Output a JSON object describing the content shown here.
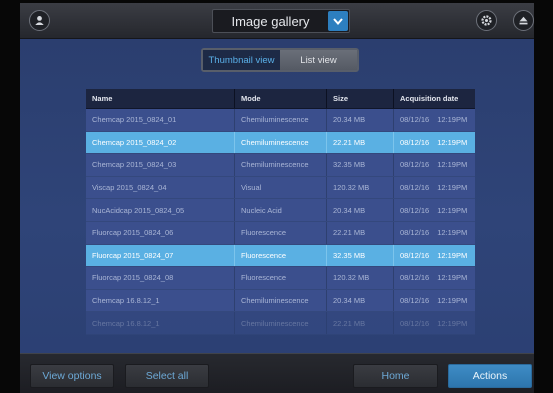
{
  "header": {
    "title": "Image gallery",
    "icons": [
      "user-icon",
      "chevron-down-icon",
      "gear-icon",
      "eject-icon"
    ]
  },
  "view_toggle": {
    "options": [
      "Thumbnail view",
      "List view"
    ],
    "selected": "Thumbnail view"
  },
  "table": {
    "columns": [
      "Name",
      "Mode",
      "Size",
      "Acquisition date"
    ],
    "rows": [
      {
        "name": "Chemcap 2015_0824_01",
        "mode": "Chemiluminescence",
        "size": "20.34 MB",
        "date": "08/12/16",
        "time": "12:19PM"
      },
      {
        "name": "Chemcap 2015_0824_02",
        "mode": "Chemiluminescence",
        "size": "22.21 MB",
        "date": "08/12/16",
        "time": "12:19PM"
      },
      {
        "name": "Chemcap 2015_0824_03",
        "mode": "Chemiluminescence",
        "size": "32.35 MB",
        "date": "08/12/16",
        "time": "12:19PM"
      },
      {
        "name": "Viscap 2015_0824_04",
        "mode": "Visual",
        "size": "120.32 MB",
        "date": "08/12/16",
        "time": "12:19PM"
      },
      {
        "name": "NucAcidcap 2015_0824_05",
        "mode": "Nucleic Acid",
        "size": "20.34 MB",
        "date": "08/12/16",
        "time": "12:19PM"
      },
      {
        "name": "Fluorcap 2015_0824_06",
        "mode": "Fluorescence",
        "size": "22.21 MB",
        "date": "08/12/16",
        "time": "12:19PM"
      },
      {
        "name": "Fluorcap 2015_0824_07",
        "mode": "Fluorescence",
        "size": "32.35 MB",
        "date": "08/12/16",
        "time": "12:19PM"
      },
      {
        "name": "Fluorcap 2015_0824_08",
        "mode": "Fluorescence",
        "size": "120.32 MB",
        "date": "08/12/16",
        "time": "12:19PM"
      },
      {
        "name": "Chemcap 16.8.12_1",
        "mode": "Chemiluminescence",
        "size": "20.34 MB",
        "date": "08/12/16",
        "time": "12:19PM"
      },
      {
        "name": "Chemcap 16.8.12_1",
        "mode": "Chemiluminescence",
        "size": "22.21 MB",
        "date": "08/12/16",
        "time": "12:19PM"
      }
    ],
    "selected_rows": [
      1,
      6
    ],
    "faded_rows": [
      9
    ]
  },
  "footer": {
    "view_options": "View options",
    "select_all": "Select all",
    "home": "Home",
    "actions": "Actions"
  },
  "colors": {
    "accent": "#5ab0e3",
    "primary_button": "#3584bd",
    "background": "#2f4478"
  }
}
